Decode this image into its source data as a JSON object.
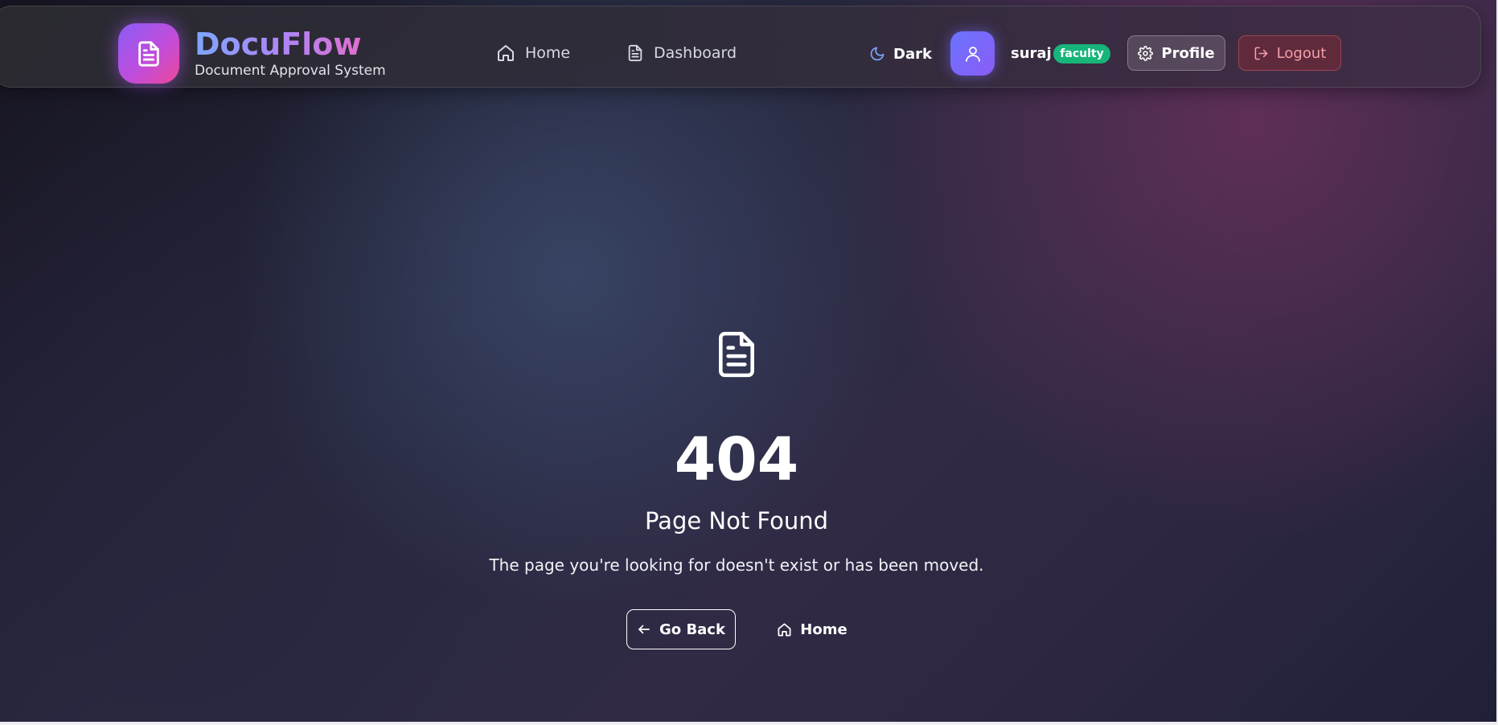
{
  "header": {
    "logo_icon": "document-icon",
    "brand_title": "DocuFlow",
    "brand_subtitle": "Document Approval System",
    "nav": [
      {
        "label": "Home",
        "icon": "home-icon"
      },
      {
        "label": "Dashboard",
        "icon": "document-icon"
      }
    ],
    "theme_toggle": {
      "label": "Dark",
      "icon": "moon-icon"
    },
    "user": {
      "avatar_icon": "user-icon",
      "name": "suraj",
      "role": "faculty"
    },
    "profile_button": {
      "label": "Profile",
      "icon": "gear-icon"
    },
    "logout_button": {
      "label": "Logout",
      "icon": "logout-icon"
    }
  },
  "main": {
    "icon": "document-icon",
    "code": "404",
    "title": "Page Not Found",
    "message": "The page you're looking for doesn't exist or has been moved.",
    "back_button": {
      "label": "Go Back",
      "icon": "arrow-left-icon"
    },
    "home_button": {
      "label": "Home",
      "icon": "home-icon"
    }
  },
  "colors": {
    "role_badge": "#17b57a",
    "logo_gradient_start": "#8b5cf6",
    "logo_gradient_end": "#ec4899",
    "logout_text": "#f3a0a8"
  }
}
